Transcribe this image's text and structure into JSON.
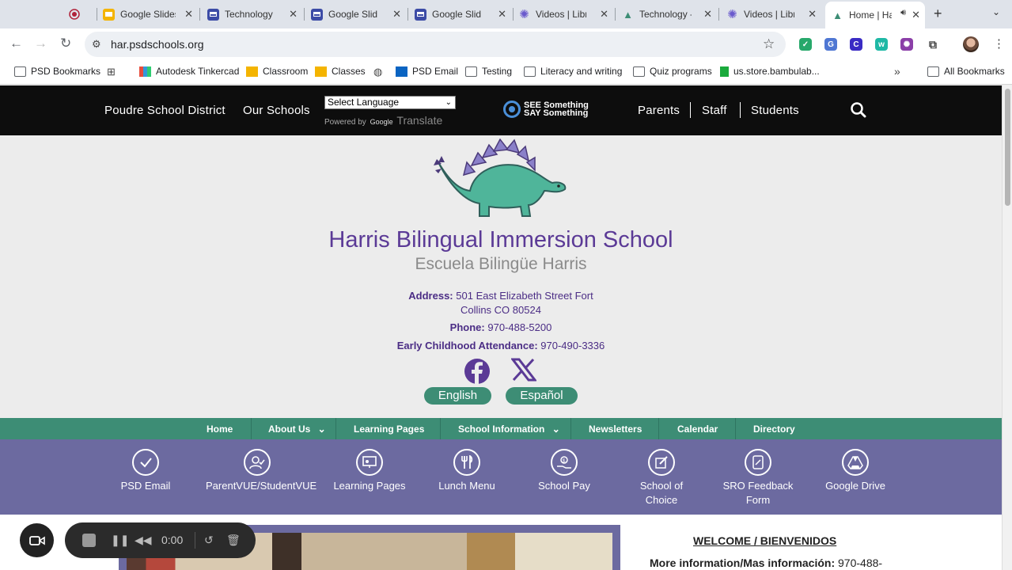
{
  "browser": {
    "tabs": [
      {
        "title": "",
        "icon": "record-icon"
      },
      {
        "title": "Google Slides",
        "icon": "slides-icon"
      },
      {
        "title": "Technology",
        "icon": "sites-icon"
      },
      {
        "title": "Google Slides",
        "icon": "sites-icon"
      },
      {
        "title": "Google Slides",
        "icon": "sites-icon"
      },
      {
        "title": "Videos | Library",
        "icon": "gear-icon"
      },
      {
        "title": "Technology - ",
        "icon": "dino-icon"
      },
      {
        "title": "Videos | Library",
        "icon": "gear-icon"
      },
      {
        "title": "Home | Ha",
        "icon": "dino-icon",
        "active": true
      }
    ],
    "url": "har.psdschools.org",
    "bookmarks": [
      {
        "label": "PSD Bookmarks",
        "icon": "folder-icon"
      },
      {
        "label": "",
        "icon": "apps-grid-icon"
      },
      {
        "label": "Autodesk Tinkercad",
        "icon": "tinkercad-icon"
      },
      {
        "label": "Classroom",
        "icon": "classroom-icon"
      },
      {
        "label": "Classes",
        "icon": "classroom-icon"
      },
      {
        "label": "",
        "icon": "globe-icon"
      },
      {
        "label": "PSD Email",
        "icon": "outlook-icon"
      },
      {
        "label": "Testing",
        "icon": "folder-icon"
      },
      {
        "label": "Literacy and writing",
        "icon": "folder-icon"
      },
      {
        "label": "Quiz programs",
        "icon": "folder-icon"
      },
      {
        "label": "us.store.bambulab...",
        "icon": "bambu-icon"
      }
    ],
    "all_bookmarks": "All Bookmarks"
  },
  "header": {
    "district": "Poudre School District",
    "schools": "Our Schools",
    "language_select": "Select Language",
    "powered_by": "Powered by",
    "google": "Google",
    "translate": "Translate",
    "ssss_line1": "SEE Something",
    "ssss_line2": "SAY Something",
    "parents": "Parents",
    "staff": "Staff",
    "students": "Students"
  },
  "hero": {
    "name": "Harris Bilingual Immersion School",
    "subtitle": "Escuela Bilingüe Harris",
    "address_label": "Address:",
    "address_line1": "501 East Elizabeth Street Fort",
    "address_line2": "Collins CO 80524",
    "phone_label": "Phone:",
    "phone": "970-488-5200",
    "ec_label": "Early Childhood Attendance:",
    "ec_phone": "970-490-3336",
    "english": "English",
    "espanol": "Español",
    "colors": {
      "purple": "#5b3a96",
      "teal": "#3d8d75"
    }
  },
  "nav": [
    {
      "label": "Home",
      "dropdown": false
    },
    {
      "label": "About Us",
      "dropdown": true
    },
    {
      "label": "Learning Pages",
      "dropdown": false
    },
    {
      "label": "School Information",
      "dropdown": true
    },
    {
      "label": "Newsletters",
      "dropdown": false
    },
    {
      "label": "Calendar",
      "dropdown": false
    },
    {
      "label": "Directory",
      "dropdown": false
    }
  ],
  "quick_links": [
    {
      "line1": "PSD Email",
      "line2": "",
      "icon": "check-icon"
    },
    {
      "line1": "ParentVUE/StudentVUE",
      "line2": "",
      "icon": "user-check-icon"
    },
    {
      "line1": "Learning Pages",
      "line2": "",
      "icon": "presentation-icon"
    },
    {
      "line1": "Lunch Menu",
      "line2": "",
      "icon": "utensils-icon"
    },
    {
      "line1": "School Pay",
      "line2": "",
      "icon": "money-hand-icon"
    },
    {
      "line1": "School of",
      "line2": "Choice",
      "icon": "edit-icon"
    },
    {
      "line1": "SRO Feedback",
      "line2": "Form",
      "icon": "form-icon"
    },
    {
      "line1": "Google Drive",
      "line2": "",
      "icon": "drive-icon"
    }
  ],
  "content": {
    "welcome": "WELCOME / BIENVENIDOS",
    "more_label": "More information/Mas información:",
    "more_value": "970-488-"
  },
  "recorder": {
    "time": "0:00"
  }
}
